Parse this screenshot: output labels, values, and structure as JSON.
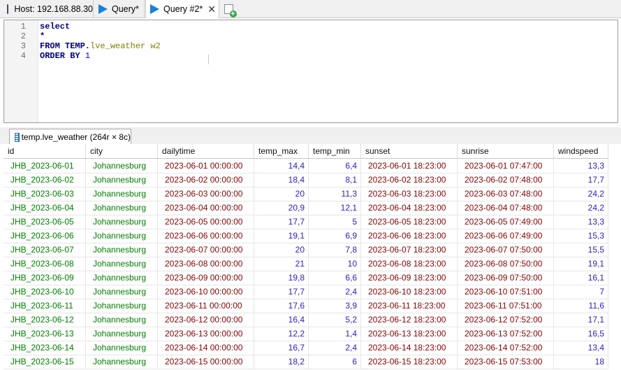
{
  "tabs": {
    "host_label": "Host: 192.168.88.30",
    "query1_label": "Query*",
    "query2_label": "Query #2*"
  },
  "editor": {
    "lines": [
      {
        "num": "1",
        "text": "select"
      },
      {
        "num": "2",
        "text": "*"
      },
      {
        "num": "3",
        "kw": "FROM TEMP.",
        "tbl": "lve_weather w2"
      },
      {
        "num": "4",
        "kw": "ORDER BY ",
        "num_val": "1"
      }
    ]
  },
  "result_tab": {
    "label": "temp.lve_weather (264r × 8c)"
  },
  "grid": {
    "columns": [
      "id",
      "city",
      "dailytime",
      "temp_max",
      "temp_min",
      "sunset",
      "sunrise",
      "windspeed"
    ],
    "rows": [
      [
        "JHB_2023-06-01",
        "Johannesburg",
        "2023-06-01 00:00:00",
        "14,4",
        "6,4",
        "2023-06-01 18:23:00",
        "2023-06-01 07:47:00",
        "13,3"
      ],
      [
        "JHB_2023-06-02",
        "Johannesburg",
        "2023-06-02 00:00:00",
        "18,4",
        "8,1",
        "2023-06-02 18:23:00",
        "2023-06-02 07:48:00",
        "17,7"
      ],
      [
        "JHB_2023-06-03",
        "Johannesburg",
        "2023-06-03 00:00:00",
        "20",
        "11,3",
        "2023-06-03 18:23:00",
        "2023-06-03 07:48:00",
        "24,2"
      ],
      [
        "JHB_2023-06-04",
        "Johannesburg",
        "2023-06-04 00:00:00",
        "20,9",
        "12,1",
        "2023-06-04 18:23:00",
        "2023-06-04 07:48:00",
        "24,2"
      ],
      [
        "JHB_2023-06-05",
        "Johannesburg",
        "2023-06-05 00:00:00",
        "17,7",
        "5",
        "2023-06-05 18:23:00",
        "2023-06-05 07:49:00",
        "13,3"
      ],
      [
        "JHB_2023-06-06",
        "Johannesburg",
        "2023-06-06 00:00:00",
        "19,1",
        "6,9",
        "2023-06-06 18:23:00",
        "2023-06-06 07:49:00",
        "15,3"
      ],
      [
        "JHB_2023-06-07",
        "Johannesburg",
        "2023-06-07 00:00:00",
        "20",
        "7,8",
        "2023-06-07 18:23:00",
        "2023-06-07 07:50:00",
        "15,5"
      ],
      [
        "JHB_2023-06-08",
        "Johannesburg",
        "2023-06-08 00:00:00",
        "21",
        "10",
        "2023-06-08 18:23:00",
        "2023-06-08 07:50:00",
        "19,1"
      ],
      [
        "JHB_2023-06-09",
        "Johannesburg",
        "2023-06-09 00:00:00",
        "19,8",
        "6,6",
        "2023-06-09 18:23:00",
        "2023-06-09 07:50:00",
        "16,1"
      ],
      [
        "JHB_2023-06-10",
        "Johannesburg",
        "2023-06-10 00:00:00",
        "17,7",
        "2,4",
        "2023-06-10 18:23:00",
        "2023-06-10 07:51:00",
        "7"
      ],
      [
        "JHB_2023-06-11",
        "Johannesburg",
        "2023-06-11 00:00:00",
        "17,6",
        "3,9",
        "2023-06-11 18:23:00",
        "2023-06-11 07:51:00",
        "11,6"
      ],
      [
        "JHB_2023-06-12",
        "Johannesburg",
        "2023-06-12 00:00:00",
        "16,4",
        "5,2",
        "2023-06-12 18:23:00",
        "2023-06-12 07:52:00",
        "17,1"
      ],
      [
        "JHB_2023-06-13",
        "Johannesburg",
        "2023-06-13 00:00:00",
        "12,2",
        "1,4",
        "2023-06-13 18:23:00",
        "2023-06-13 07:52:00",
        "16,5"
      ],
      [
        "JHB_2023-06-14",
        "Johannesburg",
        "2023-06-14 00:00:00",
        "16,7",
        "2,4",
        "2023-06-14 18:23:00",
        "2023-06-14 07:52:00",
        "13,4"
      ],
      [
        "JHB_2023-06-15",
        "Johannesburg",
        "2023-06-15 00:00:00",
        "18,2",
        "6",
        "2023-06-15 18:23:00",
        "2023-06-15 07:53:00",
        "18"
      ]
    ]
  }
}
